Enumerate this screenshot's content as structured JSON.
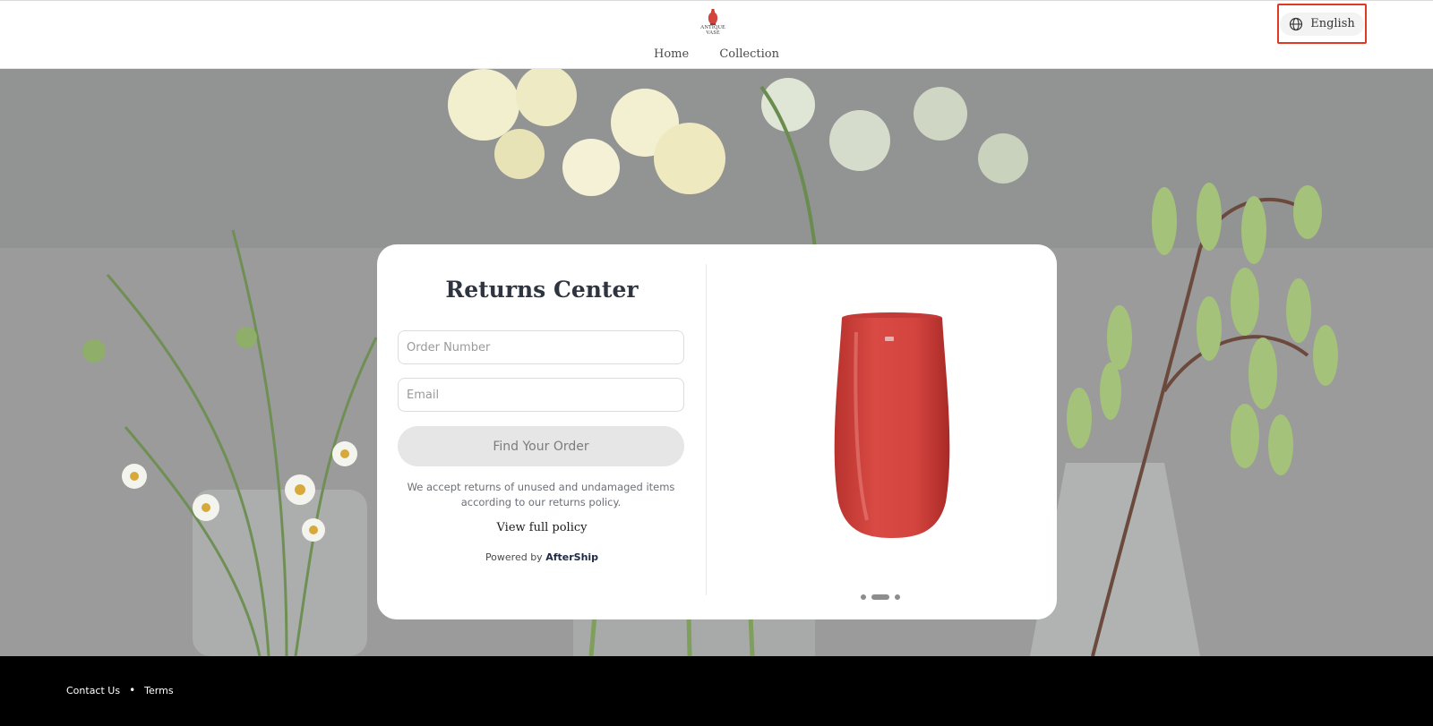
{
  "header": {
    "logo_text": "ANTIQUE VASE",
    "nav": [
      {
        "label": "Home"
      },
      {
        "label": "Collection"
      }
    ],
    "language": "English"
  },
  "card": {
    "title": "Returns Center",
    "order_number_placeholder": "Order Number",
    "email_placeholder": "Email",
    "find_button": "Find Your Order",
    "policy_text": "We accept returns of unused and undamaged items according to our returns policy.",
    "policy_link": "View full policy",
    "powered_by": "Powered by",
    "powered_brand": "AfterShip",
    "carousel": {
      "total": 3,
      "active": 2
    }
  },
  "footer": {
    "links": [
      {
        "label": "Contact Us"
      },
      {
        "label": "Terms"
      }
    ],
    "separator": "•"
  },
  "colors": {
    "highlight": "#e03a22",
    "vase": "#d2453f",
    "button_bg": "#e6e6e6",
    "footer_bg": "#000000"
  }
}
